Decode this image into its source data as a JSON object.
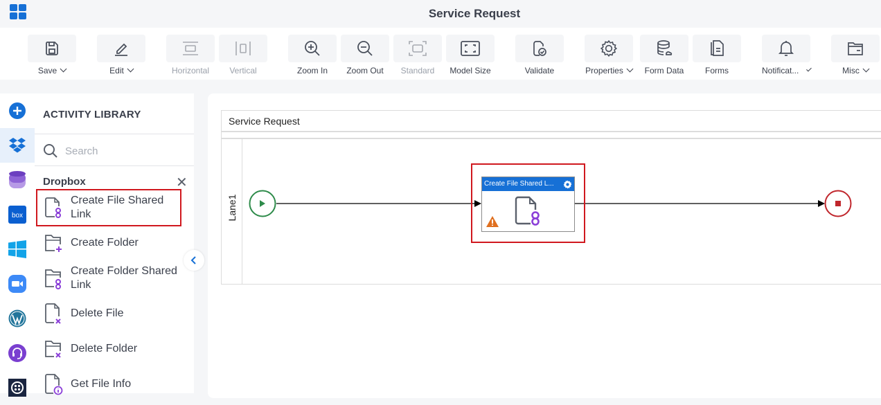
{
  "header": {
    "title": "Service Request",
    "app_menu_icon": "app-grid-icon"
  },
  "toolbar": {
    "items": [
      {
        "id": "save",
        "label": "Save",
        "icon": "save-icon",
        "dropdown": true,
        "disabled": false
      },
      {
        "id": "edit",
        "label": "Edit",
        "icon": "pencil-icon",
        "dropdown": true,
        "disabled": false
      },
      {
        "id": "horizontal",
        "label": "Horizontal",
        "icon": "horizontal-layout-icon",
        "dropdown": false,
        "disabled": true
      },
      {
        "id": "vertical",
        "label": "Vertical",
        "icon": "vertical-layout-icon",
        "dropdown": false,
        "disabled": true
      },
      {
        "id": "zoom-in",
        "label": "Zoom In",
        "icon": "zoom-in-icon",
        "dropdown": false,
        "disabled": false
      },
      {
        "id": "zoom-out",
        "label": "Zoom Out",
        "icon": "zoom-out-icon",
        "dropdown": false,
        "disabled": false
      },
      {
        "id": "standard",
        "label": "Standard",
        "icon": "standard-size-icon",
        "dropdown": false,
        "disabled": true
      },
      {
        "id": "model-size",
        "label": "Model Size",
        "icon": "fit-screen-icon",
        "dropdown": false,
        "disabled": false
      },
      {
        "id": "validate",
        "label": "Validate",
        "icon": "validate-icon",
        "dropdown": false,
        "disabled": false
      },
      {
        "id": "properties",
        "label": "Properties",
        "icon": "gear-icon",
        "dropdown": true,
        "disabled": false
      },
      {
        "id": "form-data",
        "label": "Form Data",
        "icon": "database-icon",
        "dropdown": false,
        "disabled": false
      },
      {
        "id": "forms",
        "label": "Forms",
        "icon": "forms-icon",
        "dropdown": false,
        "disabled": false
      },
      {
        "id": "notifications",
        "label": "Notificat...",
        "icon": "bell-icon",
        "dropdown": true,
        "disabled": false
      },
      {
        "id": "misc",
        "label": "Misc",
        "icon": "folder-icon",
        "dropdown": true,
        "disabled": false
      }
    ]
  },
  "rail": {
    "items": [
      {
        "name": "add",
        "icon": "add-circle-icon",
        "active": false
      },
      {
        "name": "dropbox",
        "icon": "dropbox-icon",
        "active": true
      },
      {
        "name": "database",
        "icon": "database-stack-icon",
        "active": false
      },
      {
        "name": "box",
        "icon": "box-icon",
        "label": "box",
        "active": false
      },
      {
        "name": "windows",
        "icon": "windows-icon",
        "active": false
      },
      {
        "name": "zoom",
        "icon": "zoom-video-icon",
        "active": false
      },
      {
        "name": "wordpress",
        "icon": "wordpress-icon",
        "active": false
      },
      {
        "name": "support",
        "icon": "headset-icon",
        "active": false
      },
      {
        "name": "twilio",
        "icon": "twilio-icon",
        "active": false
      }
    ]
  },
  "library": {
    "title": "ACTIVITY LIBRARY",
    "search_placeholder": "Search",
    "search_value": "",
    "category": "Dropbox",
    "items": [
      {
        "label": "Create File Shared Link",
        "icon": "file-link-icon",
        "selected": true
      },
      {
        "label": "Create Folder",
        "icon": "folder-add-icon",
        "selected": false
      },
      {
        "label": "Create Folder Shared Link",
        "icon": "folder-link-icon",
        "selected": false
      },
      {
        "label": "Delete File",
        "icon": "file-delete-icon",
        "selected": false
      },
      {
        "label": "Delete Folder",
        "icon": "folder-delete-icon",
        "selected": false
      },
      {
        "label": "Get File Info",
        "icon": "file-info-icon",
        "selected": false
      }
    ]
  },
  "canvas": {
    "pool_title": "Service Request",
    "lane_label": "Lane1",
    "task": {
      "title": "Create File Shared L...",
      "icon": "file-link-icon",
      "warning": true
    },
    "colors": {
      "start": "#2e8b4a",
      "end": "#c0262c",
      "task_header": "#1670d6",
      "selection": "#d0181e",
      "warning": "#e07020"
    }
  }
}
